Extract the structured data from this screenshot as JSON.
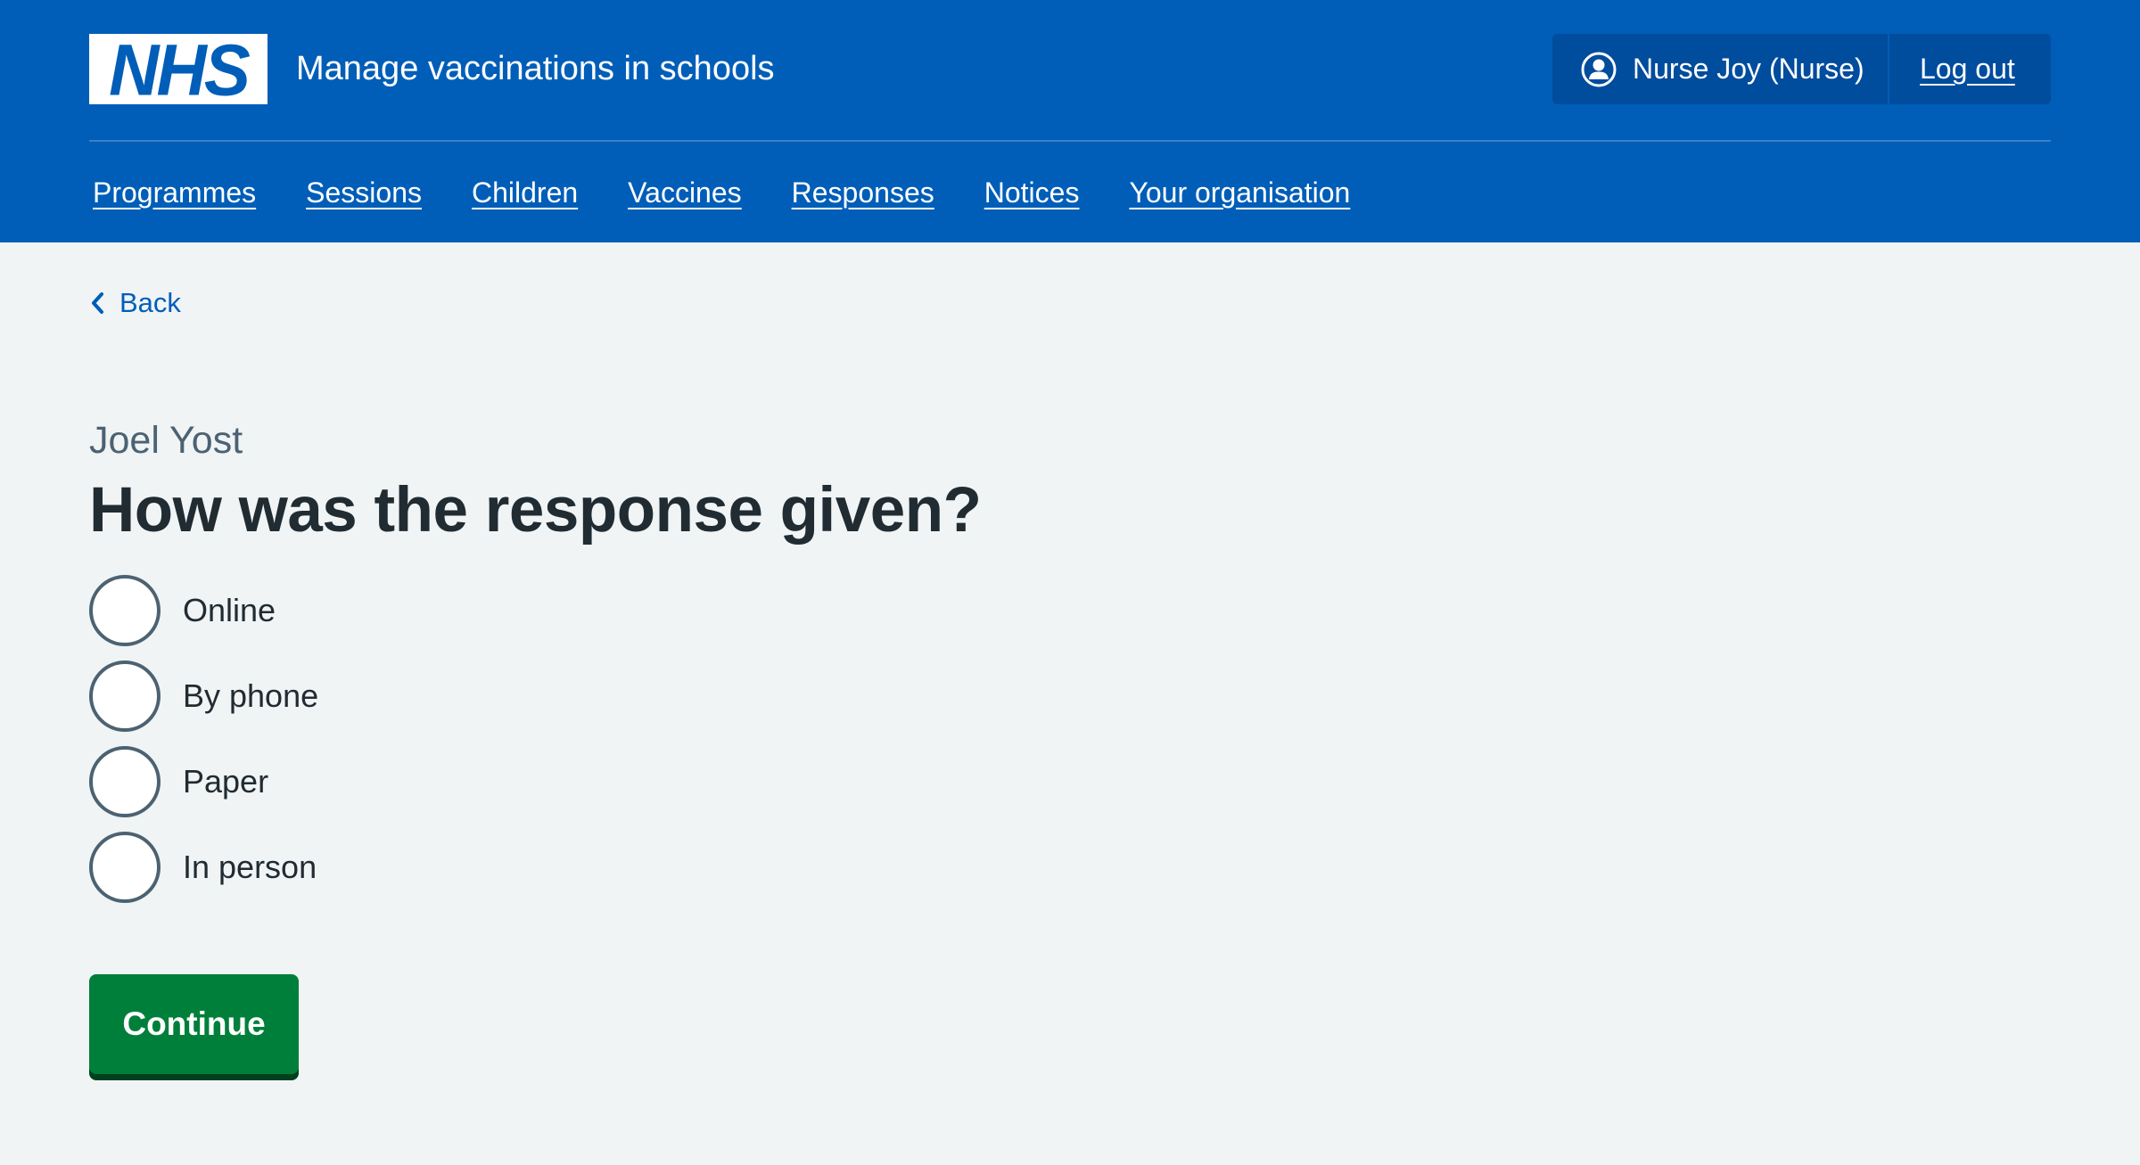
{
  "header": {
    "logo_text": "NHS",
    "service_name": "Manage vaccinations in schools",
    "account": {
      "user_icon": "user-circle-icon",
      "user_name": "Nurse Joy (Nurse)",
      "logout_label": "Log out"
    },
    "nav": [
      {
        "label": "Programmes"
      },
      {
        "label": "Sessions"
      },
      {
        "label": "Children"
      },
      {
        "label": "Vaccines"
      },
      {
        "label": "Responses"
      },
      {
        "label": "Notices"
      },
      {
        "label": "Your organisation"
      }
    ]
  },
  "back": {
    "icon": "chevron-left-icon",
    "label": "Back"
  },
  "form": {
    "caption": "Joel Yost",
    "question": "How was the response given?",
    "options": [
      {
        "label": "Online",
        "selected": false
      },
      {
        "label": "By phone",
        "selected": false
      },
      {
        "label": "Paper",
        "selected": false
      },
      {
        "label": "In person",
        "selected": false
      }
    ],
    "submit_label": "Continue"
  },
  "colors": {
    "brand_blue": "#005eb8",
    "account_bg": "#004c9d",
    "page_bg": "#f0f4f5",
    "text": "#212b32",
    "secondary_text": "#4c6272",
    "button_green": "#007f3b",
    "button_shadow": "#00401e"
  }
}
